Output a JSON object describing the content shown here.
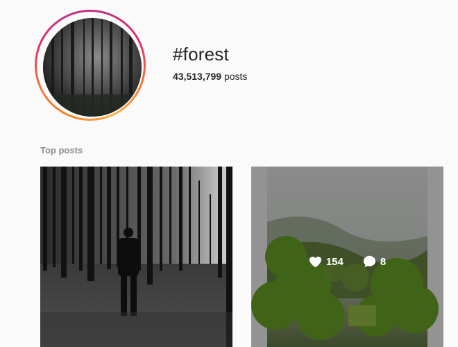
{
  "header": {
    "hashtag": "#forest",
    "post_count": "43,513,799",
    "post_count_suffix": "posts"
  },
  "sections": {
    "top_posts_label": "Top posts"
  },
  "posts": [
    {
      "image": "man-walking-in-dark-forest"
    },
    {
      "image": "misty-green-forest-hills",
      "likes": "154",
      "comments": "8"
    }
  ],
  "icons": {
    "likes": "heart-icon",
    "comments": "comment-bubble-icon"
  },
  "colors": {
    "background": "#fafafa",
    "text": "#262626",
    "muted_text": "#8e8e8e",
    "story_ring_start": "#f58529",
    "story_ring_end": "#c13584"
  }
}
